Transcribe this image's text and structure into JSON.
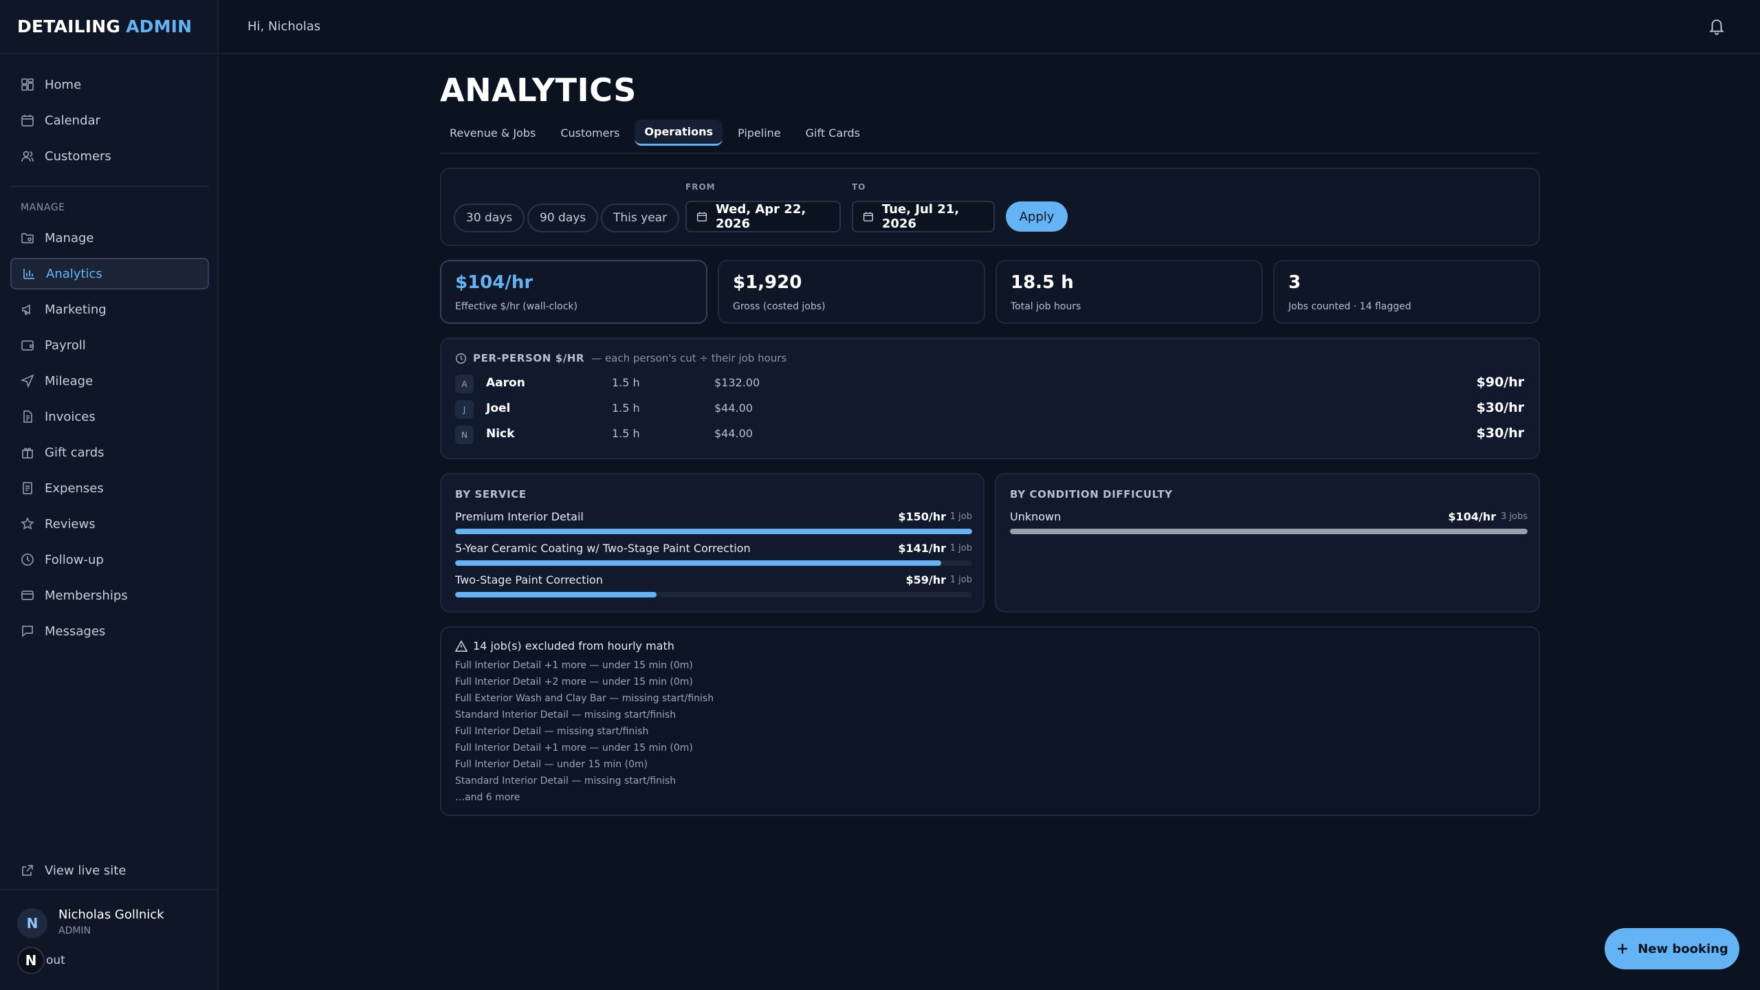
{
  "brand": {
    "name": "DETAILING",
    "accent": "ADMIN"
  },
  "topbar": {
    "greeting": "Hi, Nicholas"
  },
  "sidebar": {
    "items": [
      {
        "label": "Home",
        "icon": "home-icon"
      },
      {
        "label": "Calendar",
        "icon": "calendar-icon"
      },
      {
        "label": "Customers",
        "icon": "users-icon"
      }
    ],
    "section_label": "MANAGE",
    "manage_items": [
      {
        "label": "Manage",
        "icon": "folder-gear-icon"
      },
      {
        "label": "Analytics",
        "icon": "bar-chart-icon",
        "active": true
      },
      {
        "label": "Marketing",
        "icon": "megaphone-icon"
      },
      {
        "label": "Payroll",
        "icon": "wallet-icon"
      },
      {
        "label": "Mileage",
        "icon": "navigation-icon"
      },
      {
        "label": "Invoices",
        "icon": "file-text-icon"
      },
      {
        "label": "Gift cards",
        "icon": "gift-icon"
      },
      {
        "label": "Expenses",
        "icon": "receipt-icon"
      },
      {
        "label": "Reviews",
        "icon": "star-icon"
      },
      {
        "label": "Follow-up",
        "icon": "clock-icon"
      },
      {
        "label": "Memberships",
        "icon": "credit-card-icon"
      },
      {
        "label": "Messages",
        "icon": "message-icon"
      }
    ],
    "view_live_site": "View live site",
    "user": {
      "initial": "N",
      "name": "Nicholas Gollnick",
      "role": "ADMIN"
    },
    "logout_badge": "N",
    "logout_label": "out"
  },
  "page": {
    "title": "ANALYTICS"
  },
  "tabs": [
    {
      "label": "Revenue & Jobs"
    },
    {
      "label": "Customers"
    },
    {
      "label": "Operations",
      "active": true
    },
    {
      "label": "Pipeline"
    },
    {
      "label": "Gift Cards"
    }
  ],
  "filters": {
    "presets": [
      "30 days",
      "90 days",
      "This year"
    ],
    "from_label": "FROM",
    "from_value": "Wed, Apr 22, 2026",
    "to_label": "TO",
    "to_value": "Tue, Jul 21, 2026",
    "apply_label": "Apply"
  },
  "kpis": [
    {
      "value": "$104/hr",
      "label": "Effective $/hr (wall-clock)"
    },
    {
      "value": "$1,920",
      "label": "Gross (costed jobs)"
    },
    {
      "value": "18.5 h",
      "label": "Total job hours"
    },
    {
      "value": "3",
      "label": "Jobs counted · 14 flagged"
    }
  ],
  "per_person": {
    "title": "PER-PERSON $/HR",
    "note": "— each person's cut ÷ their job hours",
    "rows": [
      {
        "initial": "A",
        "name": "Aaron",
        "hours": "1.5 h",
        "cut": "$132.00",
        "rate": "$90/hr"
      },
      {
        "initial": "J",
        "name": "Joel",
        "hours": "1.5 h",
        "cut": "$44.00",
        "rate": "$30/hr"
      },
      {
        "initial": "N",
        "name": "Nick",
        "hours": "1.5 h",
        "cut": "$44.00",
        "rate": "$30/hr"
      }
    ]
  },
  "by_service": {
    "title": "BY SERVICE",
    "rows": [
      {
        "label": "Premium Interior Detail",
        "rate": "$150/hr",
        "jobs": "1 job",
        "fill": 1.0
      },
      {
        "label": "5-Year Ceramic Coating w/ Two-Stage Paint Correction",
        "rate": "$141/hr",
        "jobs": "1 job",
        "fill": 0.94
      },
      {
        "label": "Two-Stage Paint Correction",
        "rate": "$59/hr",
        "jobs": "1 job",
        "fill": 0.39
      }
    ]
  },
  "by_condition": {
    "title": "BY CONDITION DIFFICULTY",
    "rows": [
      {
        "label": "Unknown",
        "rate": "$104/hr",
        "jobs": "3 jobs",
        "fill": 1.0
      }
    ]
  },
  "excluded": {
    "title": "14 job(s) excluded from hourly math",
    "items": [
      "Full Interior Detail +1 more — under 15 min (0m)",
      "Full Interior Detail +2 more — under 15 min (0m)",
      "Full Exterior Wash and Clay Bar — missing start/finish",
      "Standard Interior Detail — missing start/finish",
      "Full Interior Detail — missing start/finish",
      "Full Interior Detail +1 more — under 15 min (0m)",
      "Full Interior Detail — under 15 min (0m)",
      "Standard Interior Detail — missing start/finish"
    ],
    "more": "…and 6 more"
  },
  "new_booking_label": "New booking",
  "colors": {
    "accent": "#64b4f5",
    "background": "#0b1220",
    "card": "#0f1727",
    "bar_gray": "#9aa0aa"
  }
}
